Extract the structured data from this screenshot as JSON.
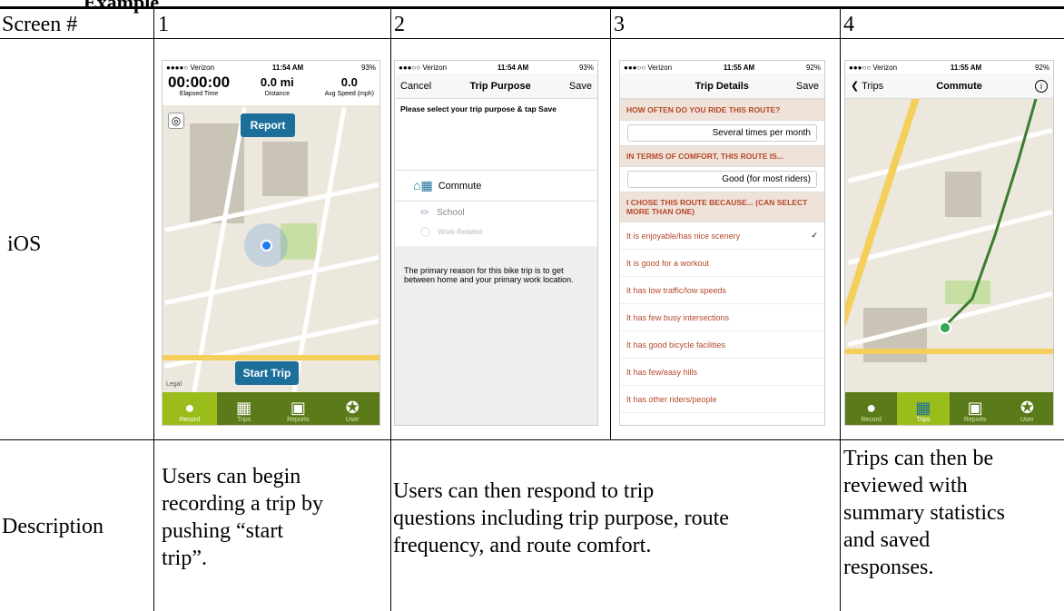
{
  "table": {
    "header_cut": "Example",
    "col_labels": [
      "Screen #",
      "1",
      "2",
      "3",
      "4"
    ],
    "row_ios": "iOS",
    "row_desc": "Description",
    "desc1": [
      "Users can begin",
      "recording a trip by",
      "pushing “start",
      "trip”."
    ],
    "desc2": [
      "Users can then respond to trip",
      "questions including trip purpose, route",
      "frequency, and route comfort."
    ],
    "desc4": [
      "Trips can then be",
      "reviewed with",
      "summary statistics",
      "and saved",
      "responses."
    ]
  },
  "screen1": {
    "carrier": "●●●●○ Verizon",
    "time": "11:54 AM",
    "battery": "93%",
    "elapsed": "00:00:00",
    "distance": "0.0 mi",
    "speed": "0.0",
    "elapsed_label": "Elapsed Time",
    "distance_label": "Distance",
    "speed_label": "Avg Speed (mph)",
    "report": "Report",
    "start_trip": "Start Trip",
    "legal": "Legal",
    "tabs": [
      "Record",
      "Trips",
      "Reports",
      "User"
    ]
  },
  "screen2": {
    "carrier": "●●●○○ Verizon",
    "time": "11:54 AM",
    "battery": "93%",
    "cancel": "Cancel",
    "title": "Trip Purpose",
    "save": "Save",
    "instruction": "Please select your trip purpose & tap Save",
    "options": [
      "Commute",
      "School",
      "Work-Related"
    ],
    "explain": "The primary reason for this bike trip is to get between home and your primary work location."
  },
  "screen3": {
    "carrier": "●●●○○ Verizon",
    "time": "11:55 AM",
    "battery": "92%",
    "title": "Trip Details",
    "save": "Save",
    "q1": "HOW OFTEN DO YOU RIDE THIS ROUTE?",
    "a1": "Several times per month",
    "q2": "IN TERMS OF COMFORT, THIS ROUTE IS...",
    "a2": "Good (for most riders)",
    "q3": "I CHOSE THIS ROUTE BECAUSE... (CAN SELECT MORE THAN ONE)",
    "reasons": [
      "It is enjoyable/has nice scenery",
      "It is good for a workout",
      "It has low traffic/low speeds",
      "It has few busy intersections",
      "It has good bicycle facilities",
      "It has few/easy hills",
      "It has other riders/people"
    ]
  },
  "screen4": {
    "carrier": "●●●○○ Verizon",
    "time": "11:55 AM",
    "battery": "92%",
    "back": "Trips",
    "title": "Commute",
    "info": "i",
    "tabs": [
      "Record",
      "Trips",
      "Reports",
      "User"
    ]
  }
}
